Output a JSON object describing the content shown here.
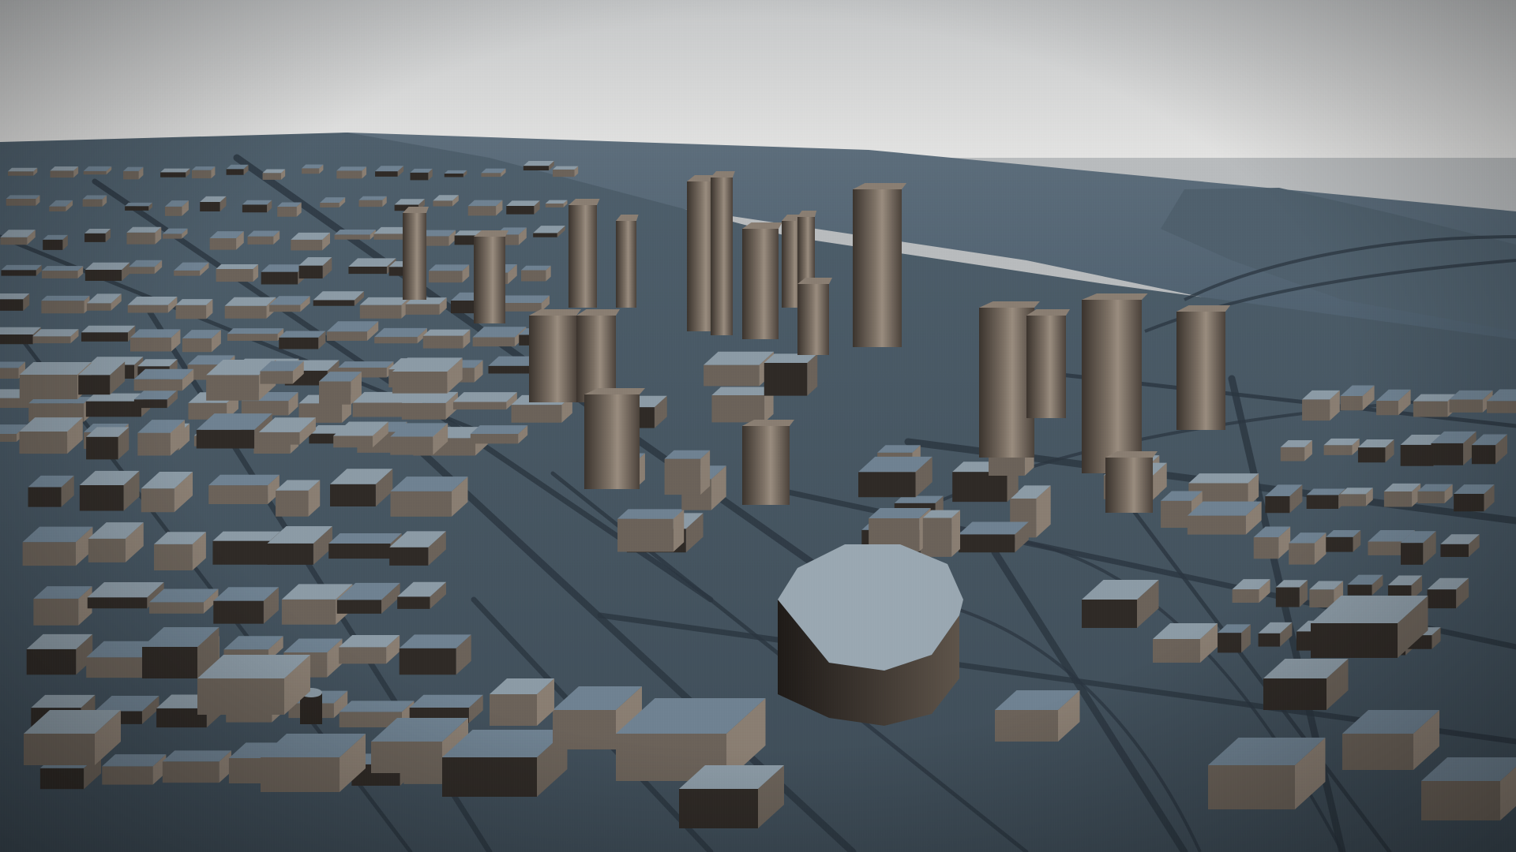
{
  "scene": {
    "description_free": true,
    "palette": {
      "sky_top": "#c6c8c9",
      "sky_horizon": "#e3e3e2",
      "water": "#4d5f6e",
      "water_far": "#5d6e7c",
      "ground": "#4e5f6c",
      "ground_near": "#3e4c57",
      "street": "#2b3640",
      "roof": "#6f8292",
      "roof_light": "#8c9ba6",
      "wall_warm": "#6b6259",
      "wall_light": "#8a7e72",
      "wall_dark": "#2f2a26",
      "arena_roof": "#9aa8b2"
    }
  }
}
